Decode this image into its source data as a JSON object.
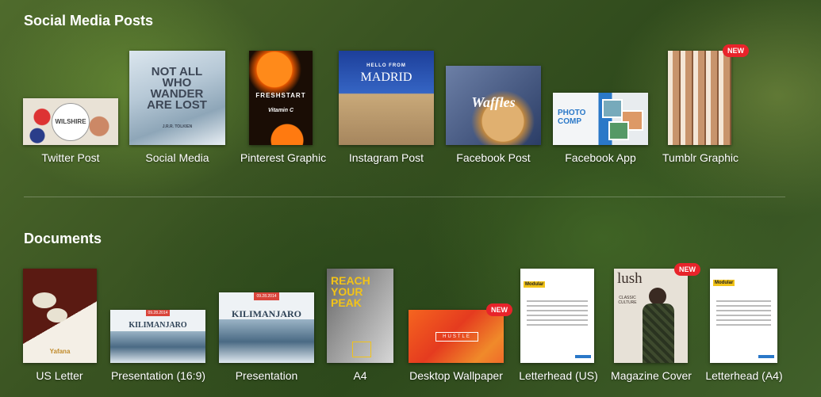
{
  "social": {
    "title": "Social Media Posts",
    "items": [
      {
        "label": "Twitter Post",
        "thumb_text": "WILSHIRE"
      },
      {
        "label": "Social Media",
        "thumb_text": "NOT ALL WHO WANDER ARE LOST",
        "thumb_sub": "J.R.R. TOLKIEN"
      },
      {
        "label": "Pinterest Graphic",
        "thumb_text": "FRESHSTART",
        "thumb_sub": "Vitamin C"
      },
      {
        "label": "Instagram Post",
        "thumb_text": "MADRID",
        "thumb_sub": "HELLO FROM"
      },
      {
        "label": "Facebook Post",
        "thumb_text": "Waffles"
      },
      {
        "label": "Facebook App",
        "thumb_text": "PHOTO COMP"
      },
      {
        "label": "Tumblr Graphic",
        "badge": "NEW"
      }
    ]
  },
  "documents": {
    "title": "Documents",
    "items": [
      {
        "label": "US Letter",
        "thumb_text": "Yafana"
      },
      {
        "label": "Presentation (16:9)",
        "thumb_text": "KILIMANJARO",
        "thumb_sub": "09.28.2014"
      },
      {
        "label": "Presentation",
        "thumb_text": "KILIMANJARO",
        "thumb_sub": "09.28.2014"
      },
      {
        "label": "A4",
        "thumb_text": "REACH YOUR PEAK"
      },
      {
        "label": "Desktop Wallpaper",
        "thumb_text": "HUSTLE",
        "badge": "NEW"
      },
      {
        "label": "Letterhead (US)",
        "thumb_text": "Modular"
      },
      {
        "label": "Magazine Cover",
        "thumb_text": "lush",
        "thumb_sub": "CLASSIC CULTURE",
        "badge": "NEW"
      },
      {
        "label": "Letterhead (A4)",
        "thumb_text": "Modular"
      }
    ]
  },
  "colors": {
    "badge": "#e8232a",
    "text": "#ffffff"
  }
}
